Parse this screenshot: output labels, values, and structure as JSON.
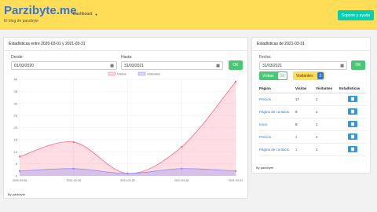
{
  "header": {
    "brand": "Parzibyte.me",
    "tagline": "El blog de parzibyte",
    "nav_dashboard": "Dashboard",
    "nav_icon": "chevron-down-icon",
    "support_button": "Soporte y ayuda"
  },
  "main_card": {
    "title": "Estadísticas entre 2020-03-01 y 2021-03-31",
    "from_label": "Desde:",
    "from_value": "01/03/2020",
    "to_label": "Hasta:",
    "to_value": "31/03/2021",
    "ok_label": "OK",
    "footer": "By parzibyte"
  },
  "side_card": {
    "title": "Estadísticas de 2021-03-31",
    "date_label": "Fecha:",
    "date_value": "31/03/2021",
    "ok_label": "OK",
    "visits_label": "Visitas",
    "visits_count": "39",
    "visitors_label": "Visitantes",
    "visitors_count": "2",
    "table_headers": [
      "Página",
      "Visitas",
      "Visitantes",
      "Estadísticas"
    ],
    "rows": [
      {
        "page": "Precios",
        "visits": "17",
        "visitors": "1"
      },
      {
        "page": "Página de contacto",
        "visits": "9",
        "visitors": "1"
      },
      {
        "page": "Inicio",
        "visits": "8",
        "visitors": "1"
      },
      {
        "page": "Precios",
        "visits": "4",
        "visitors": "1"
      },
      {
        "page": "Página de contacto",
        "visits": "1",
        "visitors": "1"
      }
    ],
    "footer": "By parzibyte"
  },
  "chart_data": {
    "type": "area",
    "x": [
      "2020-03-08",
      "2021-02-28",
      "2021-03-25",
      "2021-03-28",
      "2021-03-31"
    ],
    "series": [
      {
        "name": "Visitas",
        "values": [
          8,
          14,
          1,
          12,
          39
        ],
        "color": "#ff6384"
      },
      {
        "name": "Visitantes",
        "values": [
          2,
          3,
          1,
          3,
          2
        ],
        "color": "#8f8cf0"
      }
    ],
    "yticks": [
      0,
      5,
      10,
      15,
      20,
      25,
      30,
      35,
      40
    ],
    "ylim": [
      0,
      40
    ],
    "legend": "top-center"
  },
  "colors": {
    "brand": "#3273dc",
    "header_bg": "#ffdd57",
    "success": "#48c774",
    "teal": "#00d1b2",
    "info": "#3298dc"
  }
}
